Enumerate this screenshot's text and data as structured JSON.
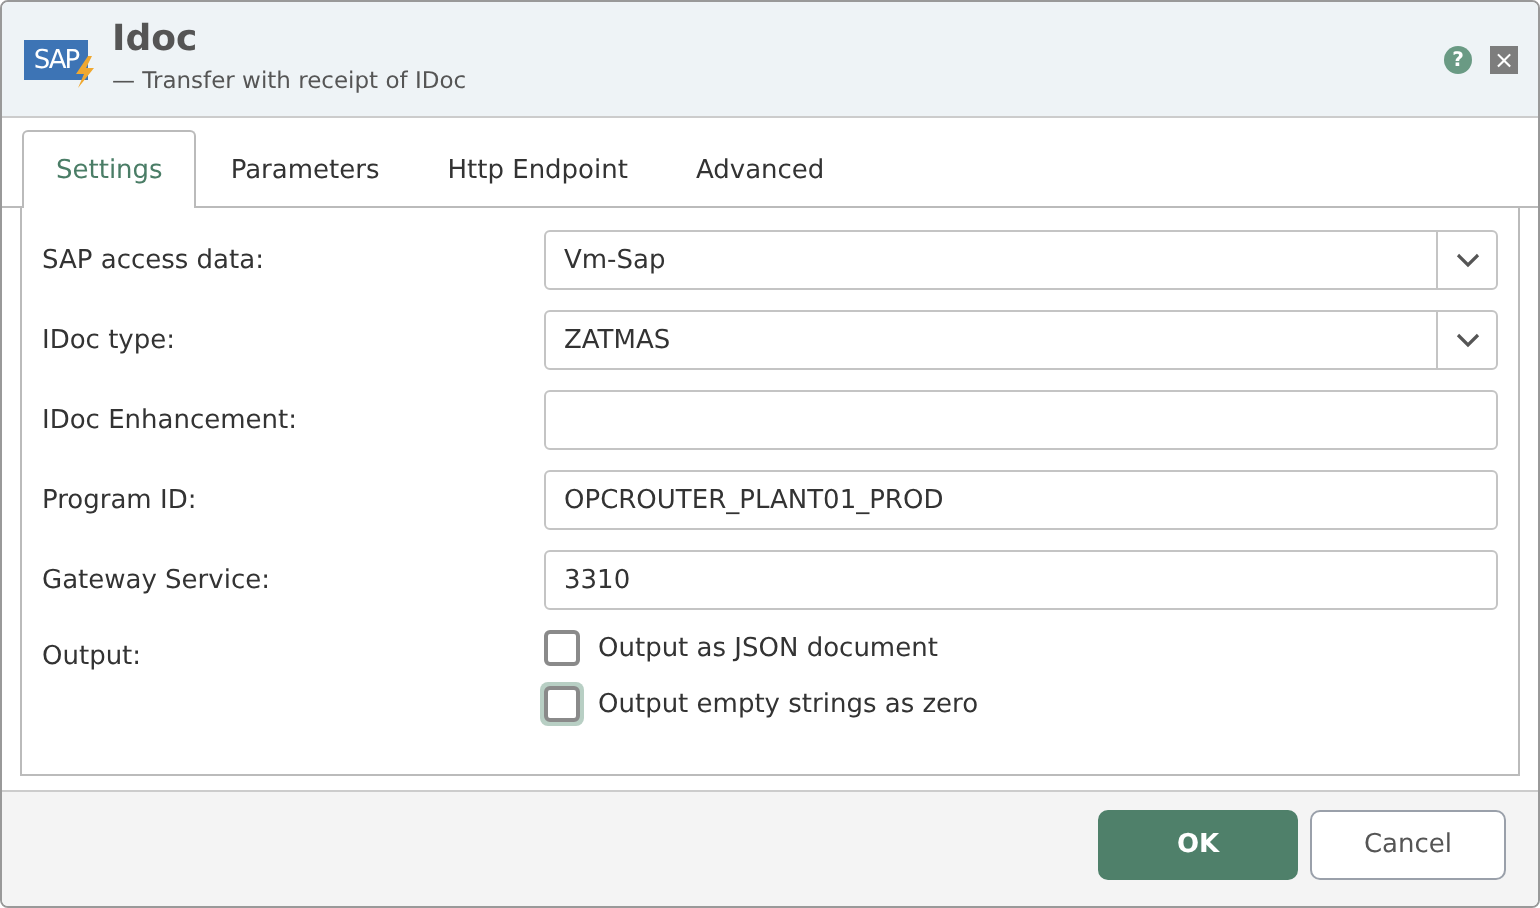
{
  "window": {
    "logo": "SAP",
    "title": "Idoc",
    "subtitle": "— Transfer with receipt of IDoc",
    "help": "?",
    "close": "×"
  },
  "tabs": [
    {
      "label": "Settings",
      "selected": true
    },
    {
      "label": "Parameters",
      "selected": false
    },
    {
      "label": "Http Endpoint",
      "selected": false
    },
    {
      "label": "Advanced",
      "selected": false
    }
  ],
  "fields": [
    {
      "label": "SAP access data:",
      "kind": "dropdown",
      "value": "Vm-Sap"
    },
    {
      "label": "IDoc type:",
      "kind": "dropdown",
      "value": "ZATMAS"
    },
    {
      "label": "IDoc Enhancement:",
      "kind": "text"
    },
    {
      "label": "Program ID:",
      "kind": "text",
      "value": "OPCROUTER_PLANT01_PROD"
    },
    {
      "label": "Gateway Service:",
      "kind": "text",
      "value": "3310"
    }
  ],
  "output": {
    "label": "Output:",
    "options": [
      {
        "label": "Output as JSON document",
        "checked": false,
        "focused": false
      },
      {
        "label": "Output empty strings as zero",
        "checked": false,
        "focused": true
      }
    ]
  },
  "buttons": [
    {
      "label": "OK",
      "kind": "primary"
    },
    {
      "label": "Cancel",
      "kind": "secondary"
    }
  ]
}
